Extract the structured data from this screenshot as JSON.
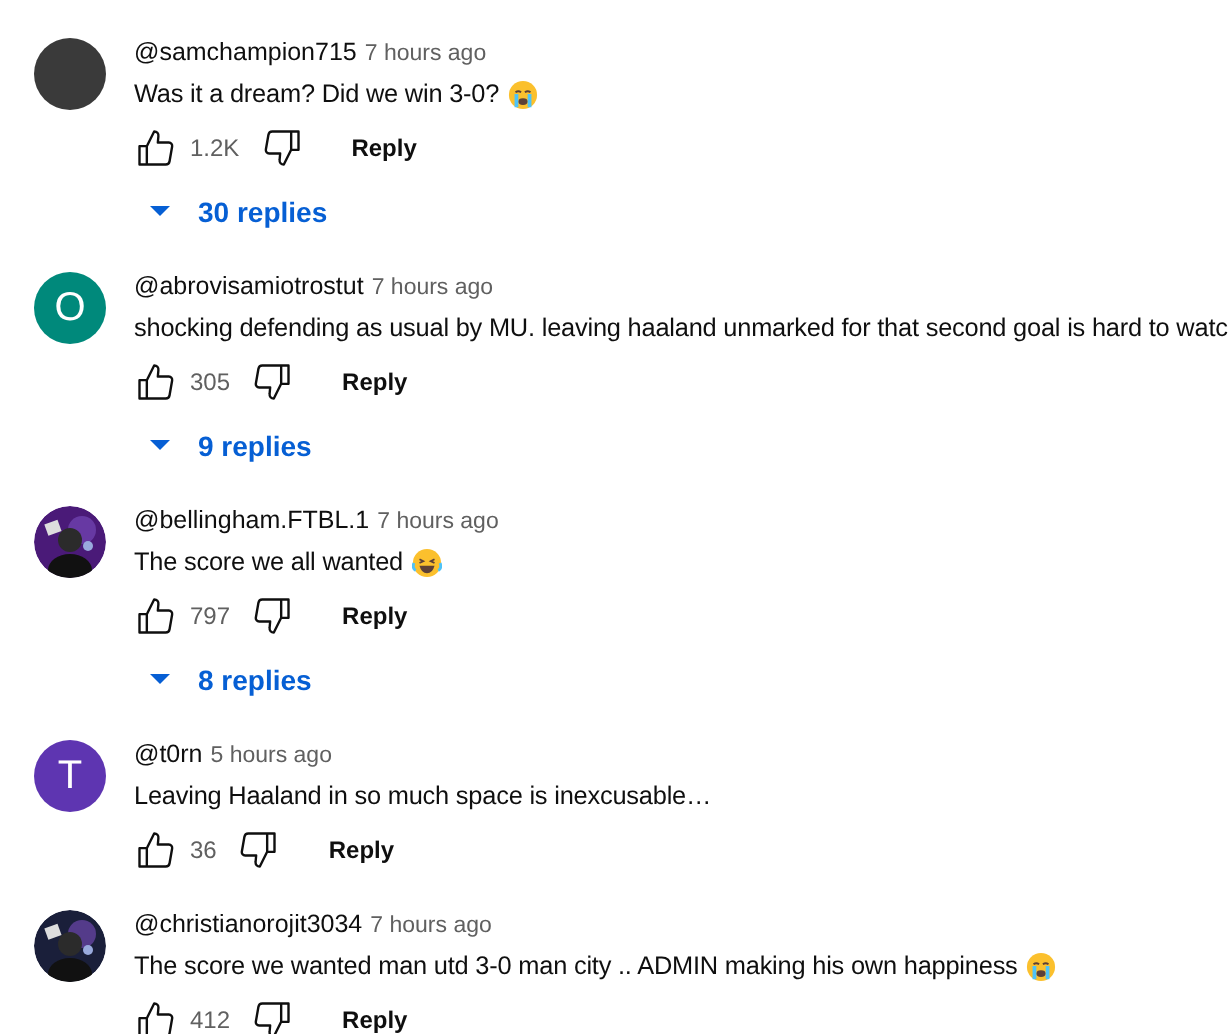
{
  "comments": [
    {
      "avatar": {
        "kind": "plain",
        "color": "#3a3a3a"
      },
      "author": "@samchampion715",
      "time": "7 hours ago",
      "text": "Was it a dream? Did we win 3-0?",
      "end_icon": {
        "kind": "crying"
      },
      "likes": "1.2K",
      "reply": "Reply",
      "replies": "30 replies"
    },
    {
      "avatar": {
        "kind": "letter",
        "letter": "O",
        "color": "#00897b"
      },
      "author": "@abrovisamiotrostut",
      "time": "7 hours ago",
      "text": "shocking defending as usual by MU. leaving haaland unmarked for that second goal is hard to watc",
      "likes": "305",
      "reply": "Reply",
      "replies": "9 replies"
    },
    {
      "author": "@bellingham.FTBL.1",
      "time": "7 hours ago",
      "text": "The score we all wanted",
      "end_icon": {
        "kind": "laughing"
      },
      "likes": "797",
      "reply": "Reply",
      "replies": "8 replies"
    },
    {
      "avatar": {
        "kind": "letter",
        "letter": "T",
        "color": "#5e35b1"
      },
      "author": "@t0rn",
      "time": "5 hours ago",
      "text": "Leaving Haaland in so much space is inexcusable…",
      "likes": "36",
      "reply": "Reply"
    },
    {
      "author": "@christianorojit3034",
      "time": "7 hours ago",
      "text": "The score we wanted man utd 3-0 man city .. ADMIN making his own happiness",
      "end_icon": {
        "kind": "crying"
      },
      "likes": "412",
      "reply": "Reply"
    }
  ]
}
